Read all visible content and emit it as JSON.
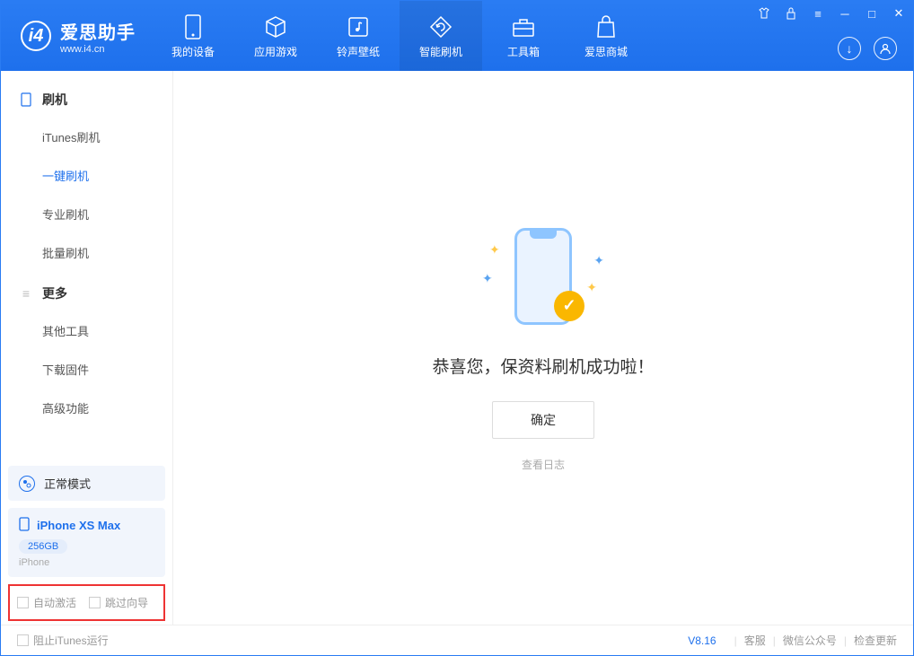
{
  "logo": {
    "title": "爱思助手",
    "subtitle": "www.i4.cn"
  },
  "nav": [
    {
      "label": "我的设备"
    },
    {
      "label": "应用游戏"
    },
    {
      "label": "铃声壁纸"
    },
    {
      "label": "智能刷机"
    },
    {
      "label": "工具箱"
    },
    {
      "label": "爱思商城"
    }
  ],
  "sidebar": {
    "section1": {
      "title": "刷机",
      "items": [
        "iTunes刷机",
        "一键刷机",
        "专业刷机",
        "批量刷机"
      ]
    },
    "section2": {
      "title": "更多",
      "items": [
        "其他工具",
        "下载固件",
        "高级功能"
      ]
    }
  },
  "device": {
    "mode": "正常模式",
    "name": "iPhone XS Max",
    "capacity": "256GB",
    "type": "iPhone"
  },
  "options": {
    "autoActivate": "自动激活",
    "skipGuide": "跳过向导"
  },
  "main": {
    "successText": "恭喜您，保资料刷机成功啦！",
    "okButton": "确定",
    "viewLog": "查看日志"
  },
  "footer": {
    "blockItunes": "阻止iTunes运行",
    "version": "V8.16",
    "support": "客服",
    "wechat": "微信公众号",
    "checkUpdate": "检查更新"
  }
}
